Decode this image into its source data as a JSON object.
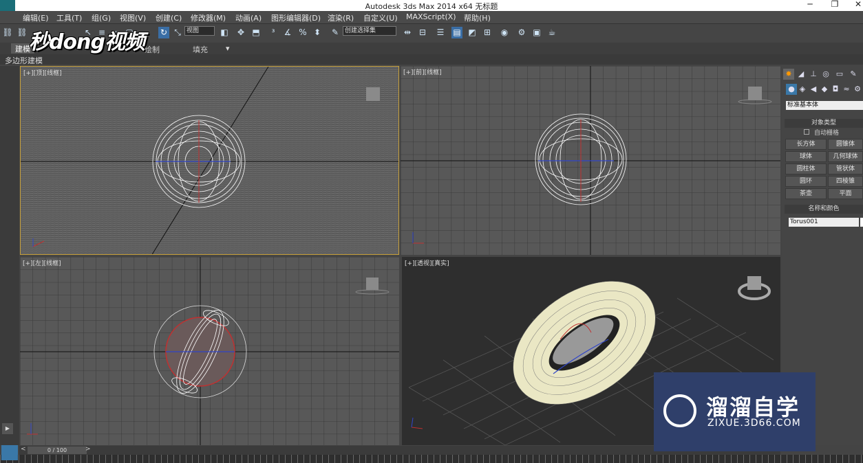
{
  "window": {
    "title": "Autodesk 3ds Max  2014 x64     无标题",
    "controls": [
      "─",
      "❐",
      "✕"
    ]
  },
  "menu": [
    "编辑(E)",
    "工具(T)",
    "组(G)",
    "视图(V)",
    "创建(C)",
    "修改器(M)",
    "动画(A)",
    "图形编辑器(D)",
    "渲染(R)",
    "自定义(U)",
    "MAXScript(X)",
    "帮助(H)"
  ],
  "toolbar": {
    "ref_coord": "视图",
    "named_selection": "创建选择集"
  },
  "ribbon": {
    "tabs": [
      "建模",
      "绘制",
      "填充"
    ],
    "active_tab": "建模",
    "subtitle": "多边形建模"
  },
  "watermark_top": "秒dong视频",
  "viewports": {
    "top": "[+][顶][线框]",
    "front": "[+][前][线框]",
    "left": "[+][左][线框]",
    "perspective": "[+][透视][真实]"
  },
  "cmd_panel": {
    "category": "标准基本体",
    "object_type_title": "对象类型",
    "autogrid": "自动栅格",
    "buttons": [
      "长方体",
      "圆锥体",
      "球体",
      "几何球体",
      "圆柱体",
      "管状体",
      "圆环",
      "四棱锥",
      "茶壶",
      "平面"
    ],
    "name_color_title": "名称和颜色",
    "object_name": "Torus001"
  },
  "timeline": {
    "frame": "0 / 100",
    "prev": "<",
    "next": ">"
  },
  "brand": {
    "name": "溜溜自学",
    "url": "ZIXUE.3D66.COM"
  }
}
